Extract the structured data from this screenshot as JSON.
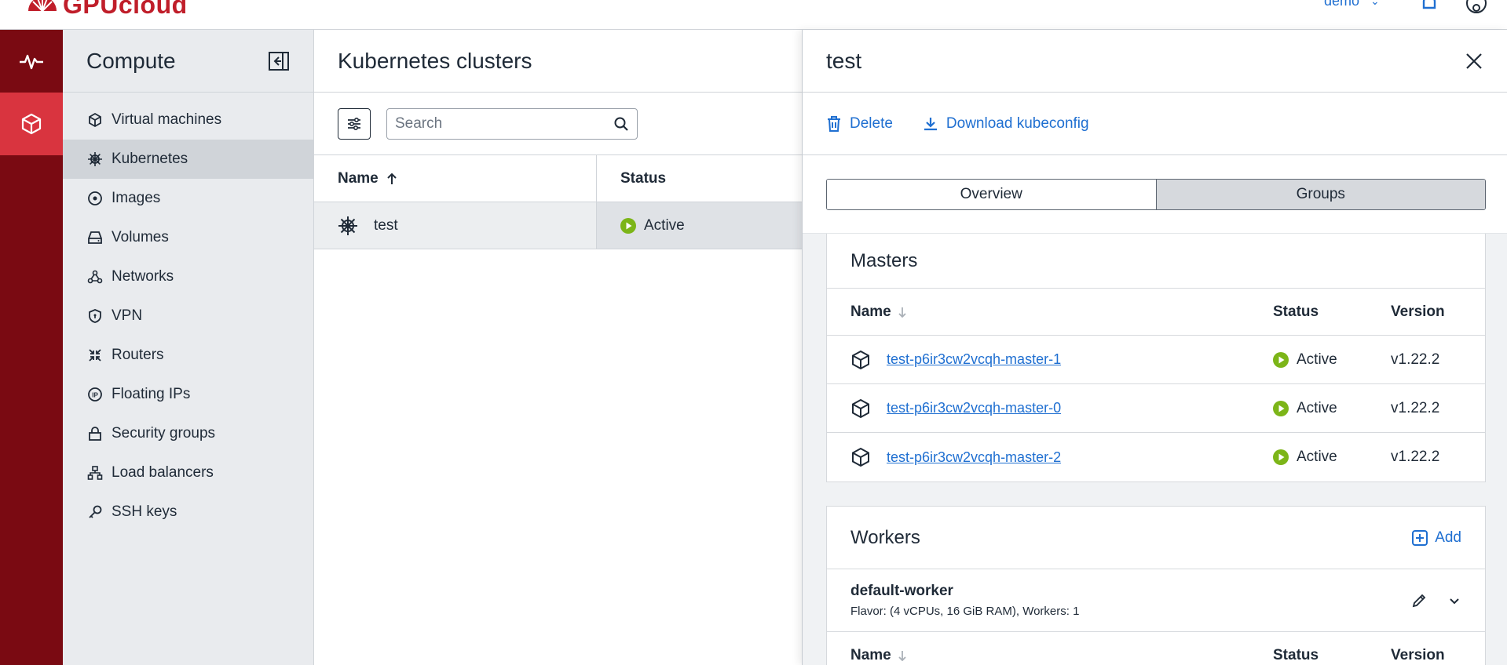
{
  "brand": {
    "name": "GPUcloud",
    "color": "#c01e2a"
  },
  "header": {
    "user": "demo",
    "bell_icon": "bell-icon",
    "account_icon": "account-icon"
  },
  "rail": {
    "items": [
      {
        "icon": "activity-icon"
      },
      {
        "icon": "cube-icon",
        "active": true
      }
    ]
  },
  "sidebar": {
    "title": "Compute",
    "items": [
      {
        "label": "Virtual machines",
        "icon": "cube-icon"
      },
      {
        "label": "Kubernetes",
        "icon": "helm-icon",
        "active": true
      },
      {
        "label": "Images",
        "icon": "disc-icon"
      },
      {
        "label": "Volumes",
        "icon": "drive-icon"
      },
      {
        "label": "Networks",
        "icon": "network-icon"
      },
      {
        "label": "VPN",
        "icon": "shield-icon"
      },
      {
        "label": "Routers",
        "icon": "router-icon"
      },
      {
        "label": "Floating IPs",
        "icon": "floating-ip-icon"
      },
      {
        "label": "Security groups",
        "icon": "lock-icon"
      },
      {
        "label": "Load balancers",
        "icon": "load-balancer-icon"
      },
      {
        "label": "SSH keys",
        "icon": "key-icon"
      }
    ]
  },
  "main": {
    "title": "Kubernetes clusters",
    "search": {
      "placeholder": "Search",
      "value": ""
    },
    "columns": {
      "name": "Name",
      "status": "Status"
    },
    "rows": [
      {
        "name": "test",
        "status": "Active"
      }
    ]
  },
  "panel": {
    "title": "test",
    "actions": {
      "delete": "Delete",
      "download": "Download kubeconfig"
    },
    "tabs": [
      {
        "label": "Overview"
      },
      {
        "label": "Groups",
        "selected": true
      }
    ],
    "masters": {
      "title": "Masters",
      "columns": {
        "name": "Name",
        "status": "Status",
        "version": "Version"
      },
      "rows": [
        {
          "name": "test-p6ir3cw2vcqh-master-1",
          "status": "Active",
          "version": "v1.22.2"
        },
        {
          "name": "test-p6ir3cw2vcqh-master-0",
          "status": "Active",
          "version": "v1.22.2"
        },
        {
          "name": "test-p6ir3cw2vcqh-master-2",
          "status": "Active",
          "version": "v1.22.2"
        }
      ]
    },
    "workers": {
      "title": "Workers",
      "add_label": "Add",
      "group": {
        "name": "default-worker",
        "description": "Flavor: (4 vCPUs, 16 GiB RAM), Workers: 1"
      },
      "columns": {
        "name": "Name",
        "status": "Status",
        "version": "Version"
      }
    }
  },
  "colors": {
    "rail": "#7a0a12",
    "rail_active": "#d9343f",
    "accent": "#1f6fd1",
    "active_status": "#7cb518"
  }
}
